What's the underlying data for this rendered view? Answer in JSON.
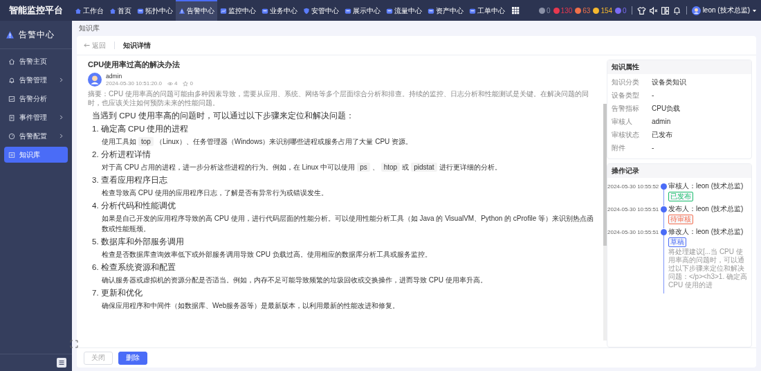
{
  "brand": "智能监控平台",
  "nav": [
    {
      "label": "工作台",
      "selected": false
    },
    {
      "label": "首页",
      "selected": false
    },
    {
      "label": "拓扑中心",
      "selected": false
    },
    {
      "label": "告警中心",
      "selected": true
    },
    {
      "label": "监控中心",
      "selected": false
    },
    {
      "label": "业务中心",
      "selected": false
    },
    {
      "label": "安管中心",
      "selected": false
    },
    {
      "label": "展示中心",
      "selected": false
    },
    {
      "label": "流量中心",
      "selected": false
    },
    {
      "label": "资产中心",
      "selected": false
    },
    {
      "label": "工单中心",
      "selected": false
    }
  ],
  "alarm_counts": [
    {
      "count": "0",
      "color": "#8a90a6"
    },
    {
      "count": "130",
      "color": "#e8384f"
    },
    {
      "count": "63",
      "color": "#f0714a"
    },
    {
      "count": "154",
      "color": "#f5b82e"
    },
    {
      "count": "0",
      "color": "#7b6cf6"
    }
  ],
  "user": "leon (技术总监)",
  "sidebar": {
    "title": "告警中心",
    "items": [
      {
        "label": "告警主页",
        "expandable": false,
        "selected": false
      },
      {
        "label": "告警管理",
        "expandable": true,
        "selected": false
      },
      {
        "label": "告警分析",
        "expandable": false,
        "selected": false
      },
      {
        "label": "事件管理",
        "expandable": true,
        "selected": false
      },
      {
        "label": "告警配置",
        "expandable": true,
        "selected": false
      },
      {
        "label": "知识库",
        "expandable": false,
        "selected": true
      }
    ]
  },
  "breadcrumb": "知识库",
  "header": {
    "back": "返回",
    "title": "知识详情"
  },
  "article": {
    "title": "CPU使用率过高的解决办法",
    "author": "admin",
    "date": "2024-05-30 10:51:20.0",
    "views": "4",
    "stars_count": "0",
    "summary": "摘要：CPU 使用率高的问题可能由多种因素导致，需要从应用、系统、网络等多个层面综合分析和排查。持续的监控、日志分析和性能测试是关键。在解决问题的同时，也应该关注如何预防未来的性能问题。",
    "intro": "当遇到 CPU 使用率高的问题时，可以通过以下步骤来定位和解决问题：",
    "sections": [
      {
        "heading": "1. 确定高 CPU 使用的进程",
        "parts": [
          {
            "kind": "text",
            "text": "使用工具如"
          },
          {
            "kind": "code",
            "text": "top"
          },
          {
            "kind": "text",
            "text": "（Linux）、任务管理器（Windows）来识别哪些进程或服务占用了大量 CPU 资源。"
          }
        ]
      },
      {
        "heading": "2. 分析进程详情",
        "parts": [
          {
            "kind": "text",
            "text": "对于高 CPU 占用的进程，进一步分析这些进程的行为。例如，在 Linux 中可以使用"
          },
          {
            "kind": "code",
            "text": "ps"
          },
          {
            "kind": "text",
            "text": "、"
          },
          {
            "kind": "code",
            "text": "htop"
          },
          {
            "kind": "text",
            "text": "或"
          },
          {
            "kind": "code",
            "text": "pidstat"
          },
          {
            "kind": "text",
            "text": "进行更详细的分析。"
          }
        ]
      },
      {
        "heading": "3. 查看应用程序日志",
        "parts": [
          {
            "kind": "text",
            "text": "检查导致高 CPU 使用的应用程序日志，了解是否有异常行为或错误发生。"
          }
        ]
      },
      {
        "heading": "4. 分析代码和性能调优",
        "parts": [
          {
            "kind": "text",
            "text": "如果是自己开发的应用程序导致的高 CPU 使用，进行代码层面的性能分析。可以使用性能分析工具（如 Java 的 VisualVM、Python 的 cProfile 等）来识别热点函数或性能瓶颈。"
          }
        ]
      },
      {
        "heading": "5. 数据库和外部服务调用",
        "parts": [
          {
            "kind": "text",
            "text": "检查是否数据库查询效率低下或外部服务调用导致 CPU 负载过高。使用相应的数据库分析工具或服务监控。"
          }
        ]
      },
      {
        "heading": "6. 检查系统资源和配置",
        "parts": [
          {
            "kind": "text",
            "text": "确认服务器或虚拟机的资源分配是否适当。例如，内存不足可能导致频繁的垃圾回收或交换操作，进而导致 CPU 使用率升高。"
          }
        ]
      },
      {
        "heading": "7. 更新和优化",
        "parts": [
          {
            "kind": "text",
            "text": "确保应用程序和中间件（如数据库、Web服务器等）是最新版本，以利用最新的性能改进和修复。"
          }
        ]
      }
    ]
  },
  "properties": {
    "title": "知识属性",
    "rows": [
      {
        "label": "知识分类",
        "value": "设备类知识"
      },
      {
        "label": "设备类型",
        "value": "-"
      },
      {
        "label": "告警指标",
        "value": "CPU负载"
      },
      {
        "label": "审核人",
        "value": "admin"
      },
      {
        "label": "审核状态",
        "value": "已发布"
      },
      {
        "label": "附件",
        "value": "-"
      }
    ]
  },
  "records": {
    "title": "操作记录",
    "items": [
      {
        "time": "2024-05-30 10:55:52",
        "actor": "审核人：leon (技术总监)",
        "tag": "已发布",
        "color": "#19be6b"
      },
      {
        "time": "2024-05-30 10:55:51",
        "actor": "发布人：leon (技术总监)",
        "tag": "待审核",
        "color": "#f56c4c"
      },
      {
        "time": "2024-05-30 10:55:51",
        "actor": "修改人：leon (技术总监)",
        "tag": "草稿",
        "color": "#4a6cf7",
        "note": "将处理建议[...当 CPU 使用率高的问题时，可以通过以下步骤来定位和解决问题：</p><h3>1. 确定高 CPU 使用的进"
      }
    ]
  },
  "buttons": [
    {
      "label": "关闭",
      "kind": "secondary"
    },
    {
      "label": "删除",
      "kind": "primary"
    }
  ]
}
